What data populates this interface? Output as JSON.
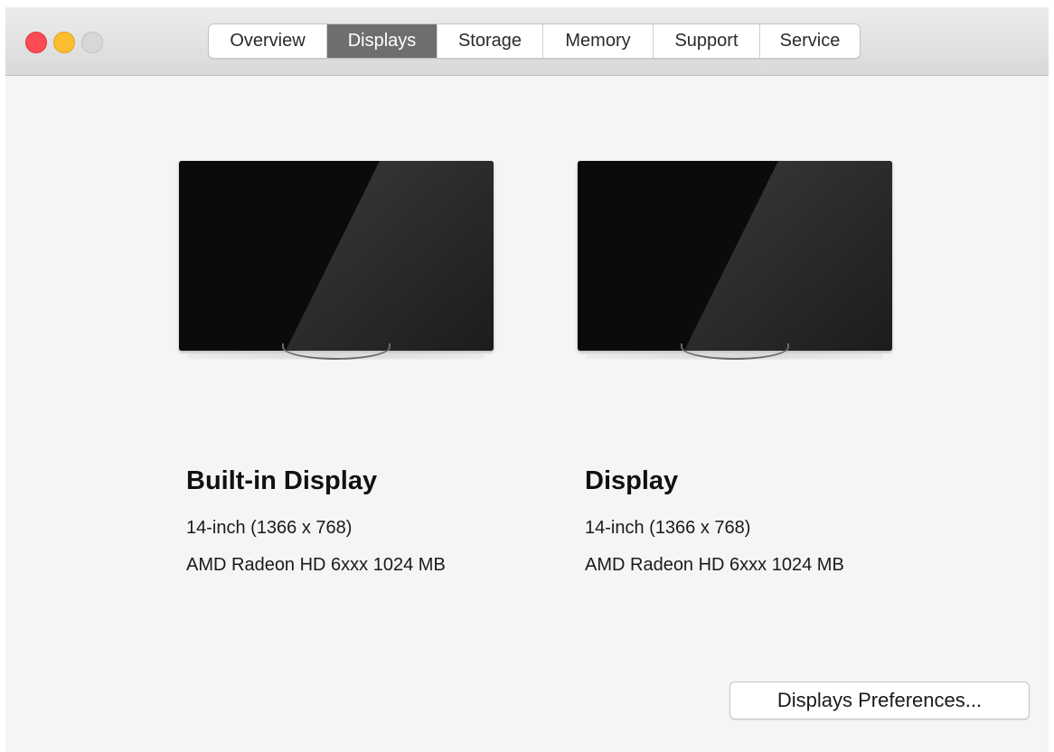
{
  "window": {
    "traffic_lights": {
      "close_color": "#fc4b55",
      "minimize_color": "#fdbd30",
      "zoom_color": "#d7d7d7"
    },
    "tabs": [
      {
        "label": "Overview",
        "active": false
      },
      {
        "label": "Displays",
        "active": true
      },
      {
        "label": "Storage",
        "active": false
      },
      {
        "label": "Memory",
        "active": false
      },
      {
        "label": "Support",
        "active": false
      },
      {
        "label": "Service",
        "active": false
      }
    ]
  },
  "displays": [
    {
      "name": "Built-in Display",
      "size": "14-inch (1366 x 768)",
      "graphics": "AMD Radeon HD 6xxx 1024 MB",
      "icon": "monitor-icon"
    },
    {
      "name": "Display",
      "size": "14-inch (1366 x 768)",
      "graphics": "AMD Radeon HD 6xxx 1024 MB",
      "icon": "monitor-icon"
    }
  ],
  "actions": {
    "preferences_label": "Displays Preferences..."
  },
  "colors": {
    "active_tab": "#6e6e6e",
    "window_background": "#f5f5f5"
  }
}
